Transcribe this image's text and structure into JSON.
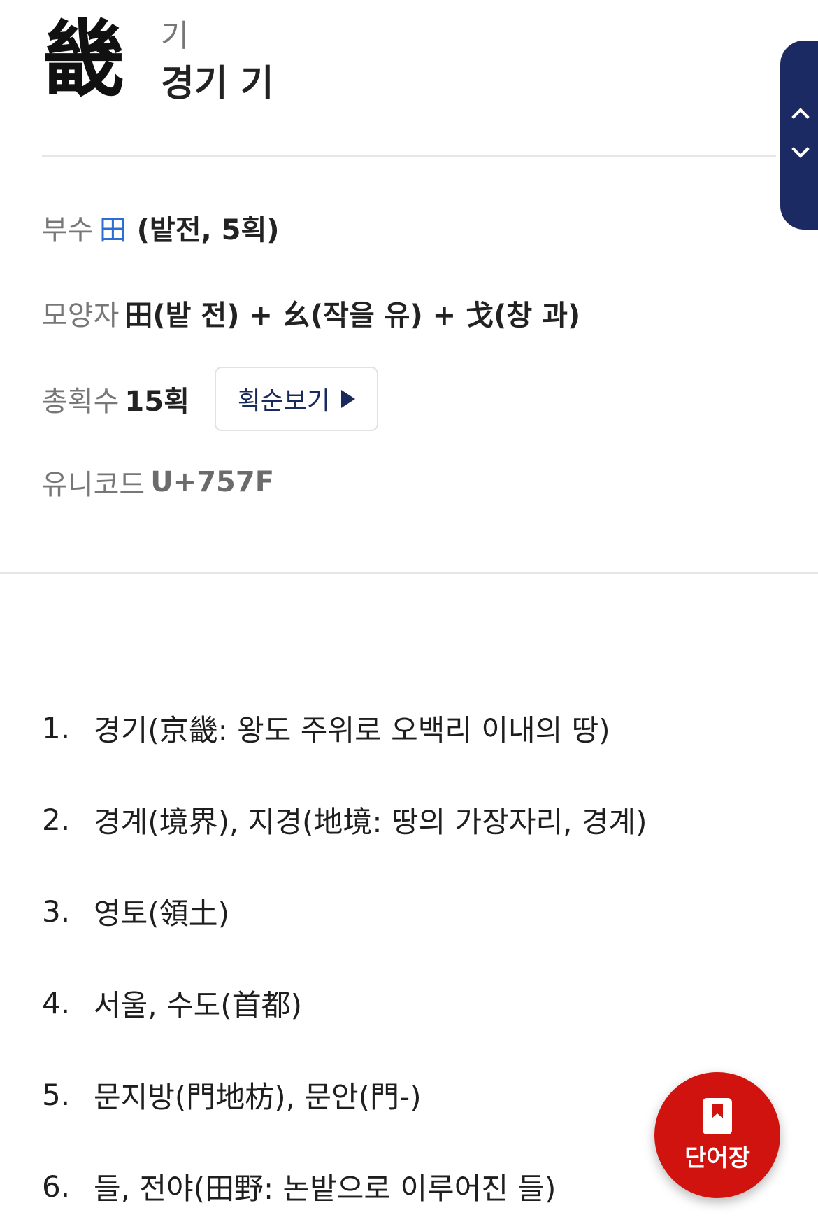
{
  "entry": {
    "character": "畿",
    "reading": "기",
    "meaning": "경기 기"
  },
  "info": {
    "radical_label": "부수",
    "radical_char": "田",
    "radical_detail": "(밭전, 5획)",
    "shape_label": "모양자",
    "shape_value": "田(밭 전) + 幺(작을 유) + 戈(창 과)",
    "strokes_label": "총획수",
    "strokes_value": "15획",
    "stroke_order_button": "획순보기",
    "unicode_label": "유니코드",
    "unicode_value": "U+757F"
  },
  "meanings": [
    {
      "num": "1.",
      "text": "경기(京畿: 왕도 주위로 오백리 이내의 땅)"
    },
    {
      "num": "2.",
      "text": "경계(境界), 지경(地境: 땅의 가장자리, 경계)"
    },
    {
      "num": "3.",
      "text": "영토(領土)"
    },
    {
      "num": "4.",
      "text": "서울, 수도(首都)"
    },
    {
      "num": "5.",
      "text": "문지방(門地枋), 문안(門-)"
    },
    {
      "num": "6.",
      "text": "들, 전야(田野: 논밭으로 이루어진 들)"
    }
  ],
  "fab": {
    "label": "단어장",
    "icon": "bookmark-icon"
  },
  "side_nav": {
    "up_icon": "chevron-up-icon",
    "down_icon": "chevron-down-icon"
  },
  "colors": {
    "accent_navy": "#1c2a63",
    "link_blue": "#2d6fd0",
    "fab_red": "#d0130f"
  }
}
